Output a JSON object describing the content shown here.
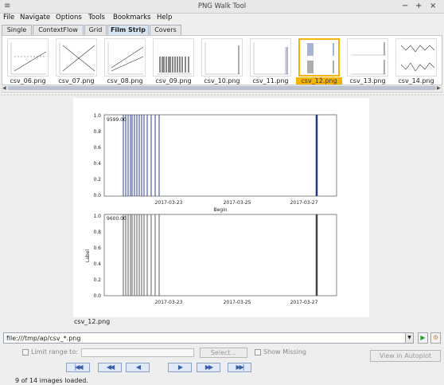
{
  "window": {
    "title": "PNG Walk Tool",
    "sys_icon": "≡",
    "min_icon": "−",
    "max_icon": "+",
    "close_icon": "×"
  },
  "menu": [
    "File",
    "Navigate",
    "Options",
    "Tools",
    "Bookmarks",
    "Help"
  ],
  "tabs": [
    "Single",
    "ContextFlow",
    "Grid",
    "Film Strip",
    "Covers"
  ],
  "active_tab": "Film Strip",
  "thumbnails": [
    "csv_06.png",
    "csv_07.png",
    "csv_08.png",
    "csv_09.png",
    "csv_10.png",
    "csv_11.png",
    "csv_12.png",
    "csv_13.png",
    "csv_14.png"
  ],
  "selected_thumbnail": "csv_12.png",
  "main_image": {
    "caption": "csv_12.png",
    "top_panel": {
      "yticks": [
        "0.0",
        "0.2",
        "0.4",
        "0.6",
        "0.8",
        "1.0"
      ],
      "note": "9599.00",
      "xlabel": "Begin",
      "xticks": [
        "2017-03-23",
        "2017-03-25",
        "2017-03-27"
      ]
    },
    "bottom_panel": {
      "yticks": [
        "0.0",
        "0.2",
        "0.4",
        "0.6",
        "0.8",
        "1.0"
      ],
      "note": "9600.00",
      "ylabel": "Label",
      "xticks": [
        "2017-03-23",
        "2017-03-25",
        "2017-03-27"
      ]
    }
  },
  "url": {
    "value": "file:///tmp/ap/csv_*.png",
    "dropdown_icon": "▼",
    "go_icon": "▶",
    "bookmark_icon": "⚙"
  },
  "controls": {
    "limit_label": "Limit range to:",
    "select_button": "Select...",
    "show_missing_label": "Show Missing",
    "autoplot_button": "View in Autoplot"
  },
  "nav_buttons": [
    "|◀◀",
    "◀◀",
    "◀",
    "▶",
    "▶▶",
    "▶▶|"
  ],
  "status": "9 of 14 images loaded.",
  "colors": {
    "selection": "#f4b400",
    "blue_bars": "#2c3f8f",
    "dark_bars": "#333333"
  }
}
